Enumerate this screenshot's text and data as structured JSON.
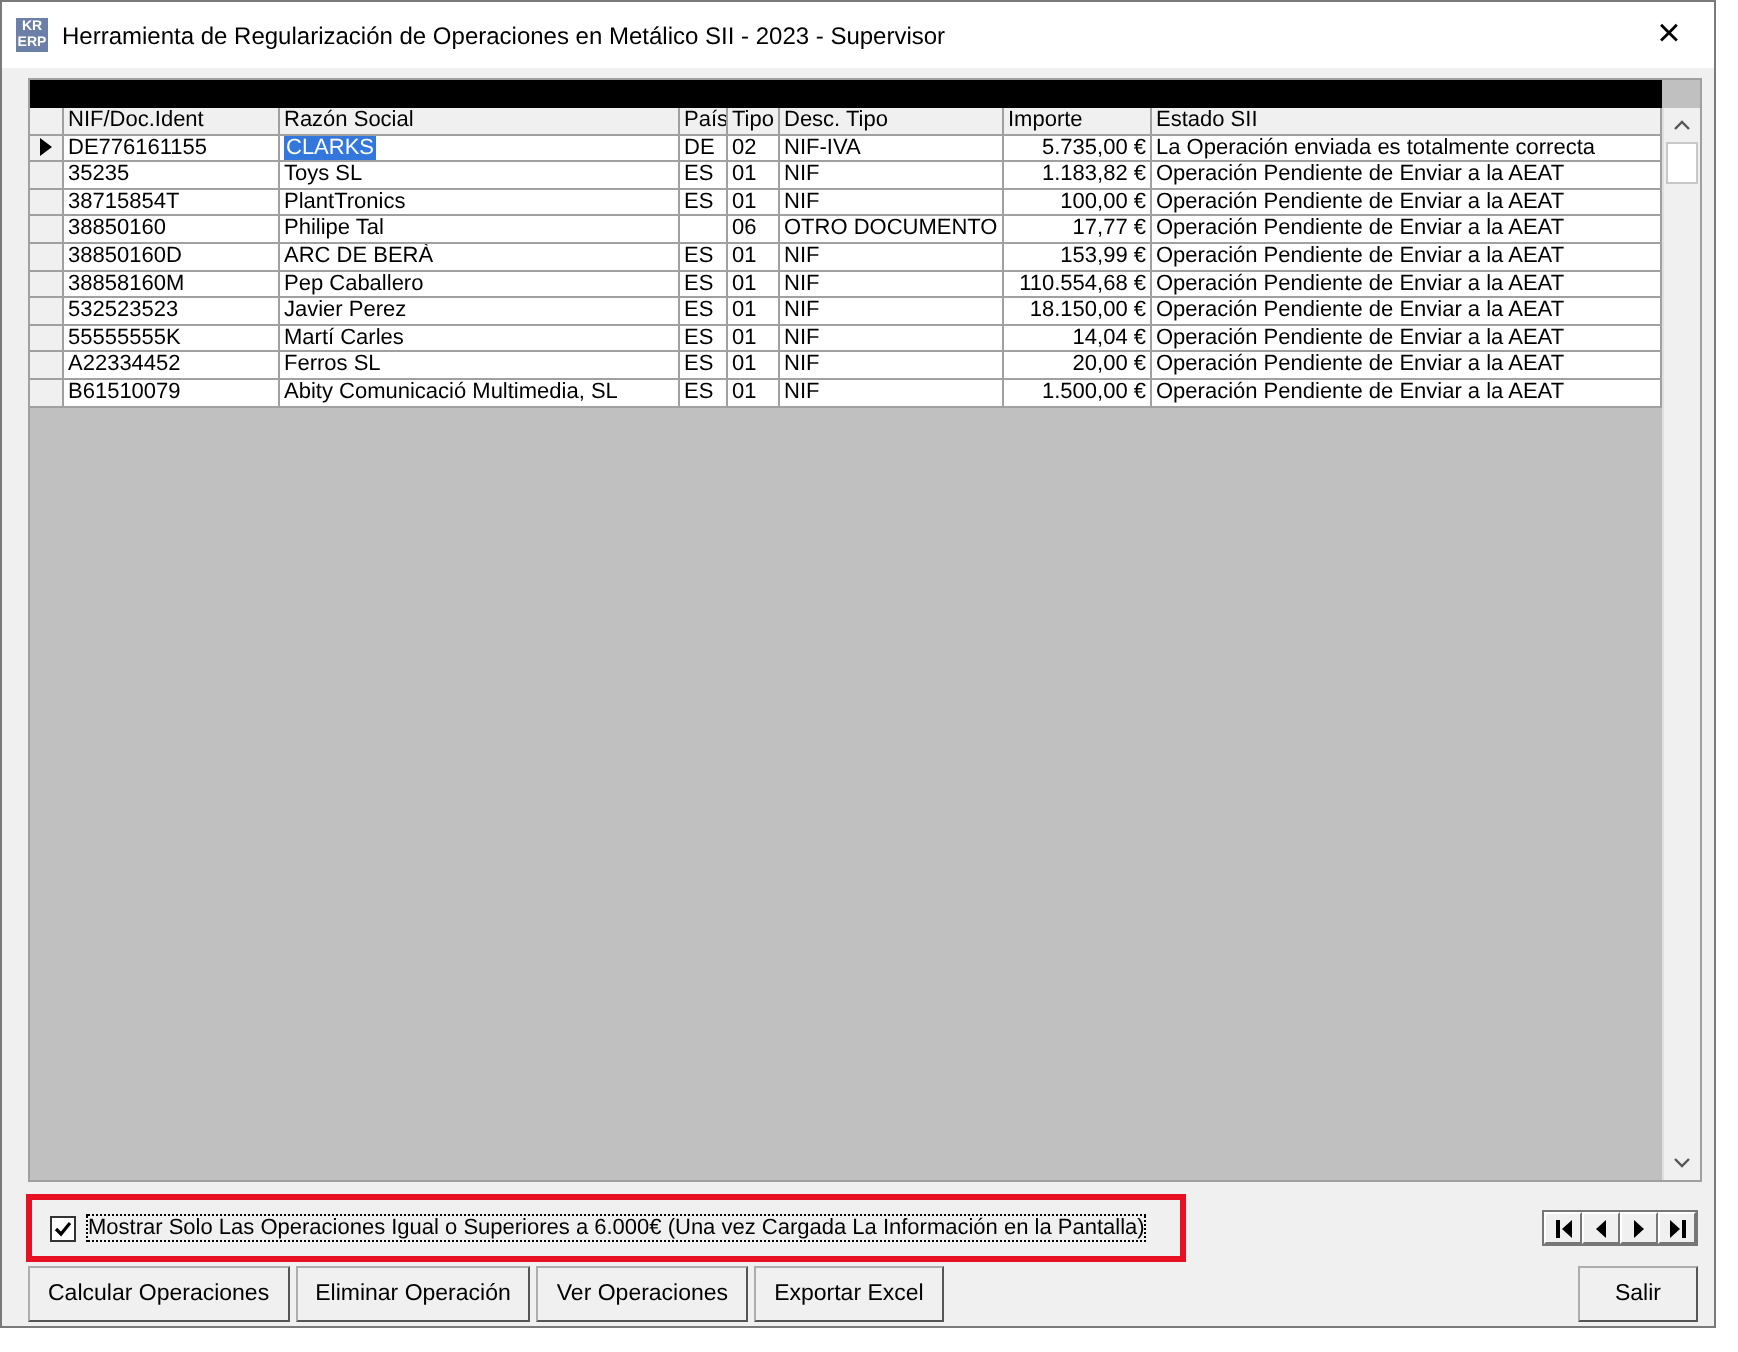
{
  "window": {
    "logo": [
      "KR",
      "ERP"
    ],
    "title": "Herramienta de Regularización de Operaciones en Metálico SII -  2023 - Supervisor",
    "close": "×"
  },
  "table": {
    "columns": [
      "NIF/Doc.Ident",
      "Razón Social",
      "País",
      "Tipo",
      "Desc. Tipo",
      "Importe",
      "Estado SII"
    ],
    "rows": [
      {
        "selected": true,
        "cells": [
          "DE776161155",
          "CLARKS",
          "DE",
          "02",
          "NIF-IVA",
          "5.735,00 €",
          "La Operación enviada es totalmente correcta"
        ]
      },
      {
        "selected": false,
        "cells": [
          "35235",
          "Toys SL",
          "ES",
          "01",
          "NIF",
          "1.183,82 €",
          "Operación Pendiente de Enviar a la AEAT"
        ]
      },
      {
        "selected": false,
        "cells": [
          "38715854T",
          "PlantTronics",
          "ES",
          "01",
          "NIF",
          "100,00 €",
          "Operación Pendiente de Enviar a la AEAT"
        ]
      },
      {
        "selected": false,
        "cells": [
          "38850160",
          "Philipe Tal",
          "",
          "06",
          "OTRO DOCUMENTO",
          "17,77 €",
          "Operación Pendiente de Enviar a la AEAT"
        ]
      },
      {
        "selected": false,
        "cells": [
          "38850160D",
          "ARC DE BERÀ",
          "ES",
          "01",
          "NIF",
          "153,99 €",
          "Operación Pendiente de Enviar a la AEAT"
        ]
      },
      {
        "selected": false,
        "cells": [
          "38858160M",
          "Pep Caballero",
          "ES",
          "01",
          "NIF",
          "110.554,68 €",
          "Operación Pendiente de Enviar a la AEAT"
        ]
      },
      {
        "selected": false,
        "cells": [
          "532523523",
          "Javier Perez",
          "ES",
          "01",
          "NIF",
          "18.150,00 €",
          "Operación Pendiente de Enviar a la AEAT"
        ]
      },
      {
        "selected": false,
        "cells": [
          "55555555K",
          "Martí Carles",
          "ES",
          "01",
          "NIF",
          "14,04 €",
          "Operación Pendiente de Enviar a la AEAT"
        ]
      },
      {
        "selected": false,
        "cells": [
          "A22334452",
          "Ferros SL",
          "ES",
          "01",
          "NIF",
          "20,00 €",
          "Operación Pendiente de Enviar a la AEAT"
        ]
      },
      {
        "selected": false,
        "cells": [
          "B61510079",
          "Abity Comunicació Multimedia, SL",
          "ES",
          "01",
          "NIF",
          "1.500,00 €",
          "Operación Pendiente de Enviar a la AEAT"
        ]
      }
    ]
  },
  "filter_option": {
    "label": "Mostrar Solo Las Operaciones Igual o Superiores a 6.000€ (Una vez Cargada La Información en la Pantalla)",
    "checked": true,
    "highlighted": true
  },
  "buttons": [
    "Calcular Operaciones",
    "Eliminar Operación",
    "Ver Operaciones",
    "Exportar Excel"
  ],
  "exit_button": "Salir"
}
